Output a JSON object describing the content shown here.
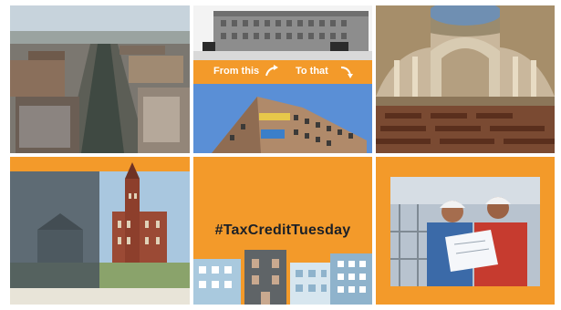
{
  "tiles": {
    "city_aerial": {
      "alt": ""
    },
    "building_compare": {
      "from_label": "From this",
      "to_label": "To that",
      "arrow_from": "curved-arrow-up-right",
      "arrow_to": "curved-arrow-down-right"
    },
    "capitol_chamber": {
      "alt": ""
    },
    "city_hall_postcard": {
      "caption": ""
    },
    "promo": {
      "hashtag": "#TaxCreditTuesday"
    },
    "workers": {
      "alt": ""
    }
  },
  "colors": {
    "orange": "#f39a2a",
    "dark": "#1b2027",
    "white": "#ffffff"
  }
}
